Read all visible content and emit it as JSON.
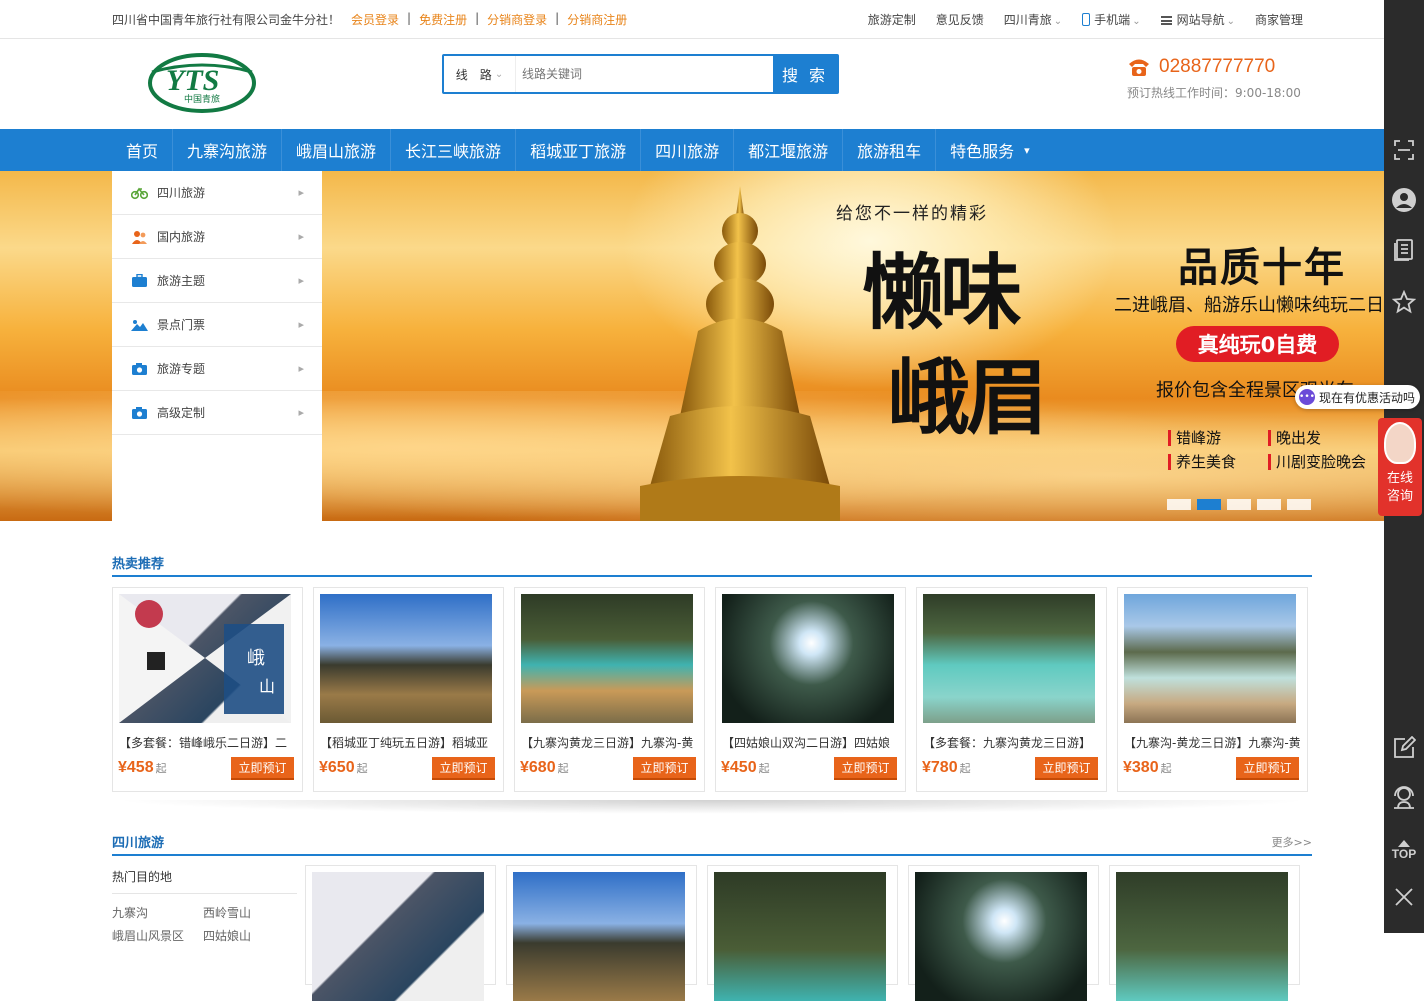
{
  "topbar": {
    "company": "四川省中国青年旅行社有限公司金牛分社！",
    "links": [
      "会员登录",
      "免费注册",
      "分销商登录",
      "分销商注册"
    ],
    "right": [
      "旅游定制",
      "意见反馈",
      "四川青旅",
      "手机端",
      "网站导航",
      "商家管理"
    ]
  },
  "header": {
    "logo_text": "YTS",
    "logo_sub": "中国青旅",
    "search_type": "线　路",
    "search_placeholder": "线路关键词",
    "search_button": "搜 索",
    "hotline": "02887777770",
    "hotline_hours": "预订热线工作时间：9:00-18:00"
  },
  "nav": [
    "首页",
    "九寨沟旅游",
    "峨眉山旅游",
    "长江三峡旅游",
    "稻城亚丁旅游",
    "四川旅游",
    "都江堰旅游",
    "旅游租车",
    "特色服务"
  ],
  "sidemenu": [
    {
      "label": "四川旅游",
      "icon": "bicycle-icon",
      "color": "#5aa63a"
    },
    {
      "label": "国内旅游",
      "icon": "people-icon",
      "color": "#e8641a"
    },
    {
      "label": "旅游主题",
      "icon": "briefcase-icon",
      "color": "#1d7fd1"
    },
    {
      "label": "景点门票",
      "icon": "landscape-icon",
      "color": "#1d7fd1"
    },
    {
      "label": "旅游专题",
      "icon": "camera-icon",
      "color": "#1d7fd1"
    },
    {
      "label": "高级定制",
      "icon": "camera-icon",
      "color": "#1d7fd1"
    }
  ],
  "banner": {
    "slogan": "给您不一样的精彩",
    "big1": "懒味",
    "big2": "峨眉",
    "quality": "品质十年",
    "sub1": "二进峨眉、船游乐山懒味纯玩二日",
    "pill": "真纯玩0自费",
    "sub2": "报价包含全程景区观光车",
    "features": [
      "错峰游",
      "晚出发",
      "养生美食",
      "川剧变脸晚会"
    ],
    "active_slide": 2,
    "slide_count": 5
  },
  "hot": {
    "title": "热卖推荐",
    "items": [
      {
        "title": "【多套餐：错峰峨乐二日游】二",
        "price": "¥458",
        "suffix": "起",
        "book": "立即预订"
      },
      {
        "title": "【稻城亚丁纯玩五日游】稻城亚",
        "price": "¥650",
        "suffix": "起",
        "book": "立即预订"
      },
      {
        "title": "【九寨沟黄龙三日游】九寨沟-黄",
        "price": "¥680",
        "suffix": "起",
        "book": "立即预订"
      },
      {
        "title": "【四姑娘山双沟二日游】四姑娘",
        "price": "¥450",
        "suffix": "起",
        "book": "立即预订"
      },
      {
        "title": "【多套餐：九寨沟黄龙三日游】",
        "price": "¥780",
        "suffix": "起",
        "book": "立即预订"
      },
      {
        "title": "【九寨沟-黄龙三日游】九寨沟-黄",
        "price": "¥380",
        "suffix": "起",
        "book": "立即预订"
      }
    ]
  },
  "sichuan": {
    "title": "四川旅游",
    "more": "更多>>",
    "dest_heading": "热门目的地",
    "destinations": [
      "九寨沟",
      "西岭雪山",
      "峨眉山风景区",
      "四姑娘山"
    ]
  },
  "float": {
    "promo": "现在有优惠活动吗",
    "consult": [
      "在线",
      "咨询"
    ]
  },
  "toolbar": {
    "top": "TOP"
  }
}
